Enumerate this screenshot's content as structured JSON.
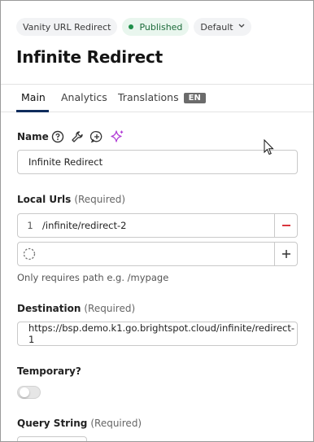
{
  "header": {
    "content_type": "Vanity URL Redirect",
    "status": "Published",
    "site": "Default",
    "title": "Infinite Redirect"
  },
  "tabs": [
    {
      "label": "Main",
      "active": true
    },
    {
      "label": "Analytics",
      "active": false
    },
    {
      "label": "Translations",
      "active": false
    }
  ],
  "language_badge": "EN",
  "fields": {
    "name": {
      "label": "Name",
      "value": "Infinite Redirect"
    },
    "local_urls": {
      "label": "Local Urls",
      "required": "(Required)",
      "items": [
        {
          "index": "1",
          "value": "/infinite/redirect-2"
        }
      ],
      "help": "Only requires path e.g. /mypage"
    },
    "destination": {
      "label": "Destination",
      "required": "(Required)",
      "value": "https://bsp.demo.k1.go.brightspot.cloud/infinite/redirect-1"
    },
    "temporary": {
      "label": "Temporary?",
      "value": false
    },
    "query_string": {
      "label": "Query String",
      "required": "(Required)"
    }
  },
  "icons": {
    "name_tools": [
      "help-icon",
      "wrench-icon",
      "add-comment-icon",
      "sparkle-ai-icon"
    ],
    "remove": "minus-icon",
    "add": "plus-icon",
    "loading": "spinner-icon"
  },
  "colors": {
    "published_green": "#1f8f4a",
    "active_tab": "#0f2c5c",
    "remove_red": "#d9363e",
    "sparkle_purple": "#b23fd6"
  }
}
